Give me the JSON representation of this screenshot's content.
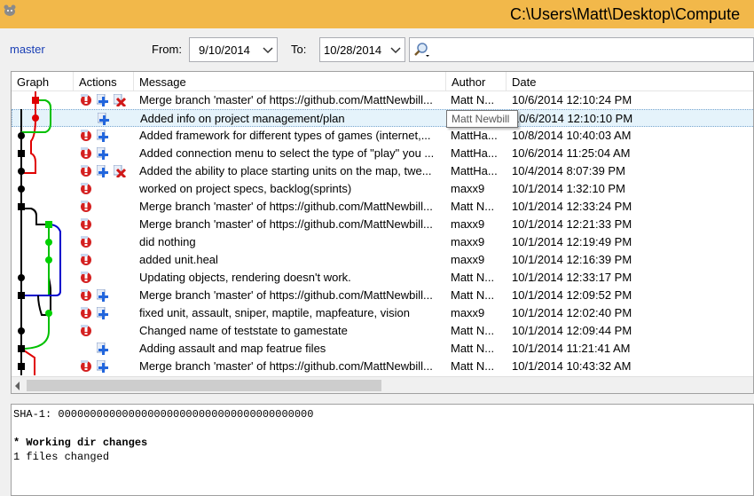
{
  "window": {
    "title": "C:\\Users\\Matt\\Desktop\\Compute"
  },
  "filter": {
    "branch": "master",
    "from_label": "From:",
    "from_date": "9/10/2014",
    "to_label": "To:",
    "to_date": "10/28/2014",
    "search_value": ""
  },
  "columns": {
    "graph": "Graph",
    "actions": "Actions",
    "message": "Message",
    "author": "Author",
    "date": "Date"
  },
  "rows": [
    {
      "message": "Merge branch 'master' of https://github.com/MattNewbill...",
      "author": "Matt N...",
      "date": "10/6/2014 12:10:24 PM",
      "actions": [
        "conflict-icon",
        "add-icon",
        "remove-icon"
      ]
    },
    {
      "message": "Added info on project management/plan",
      "author": "Matt N...",
      "date": "10/6/2014 12:10:10 PM",
      "actions": [
        "add-icon"
      ]
    },
    {
      "message": "Added framework for different types of games (internet,...",
      "author": "MattHa...",
      "date": "10/8/2014 10:40:03 AM",
      "actions": [
        "conflict-icon",
        "add-icon"
      ]
    },
    {
      "message": "Added connection menu to select the type of \"play\" you ...",
      "author": "MattHa...",
      "date": "10/6/2014 11:25:04 AM",
      "actions": [
        "conflict-icon",
        "add-icon"
      ]
    },
    {
      "message": "Added the ability to place starting units on the map, twe...",
      "author": "MattHa...",
      "date": "10/4/2014 8:07:39 PM",
      "actions": [
        "conflict-icon",
        "add-icon",
        "remove-icon"
      ]
    },
    {
      "message": "worked on project specs, backlog(sprints)",
      "author": "maxx9",
      "date": "10/1/2014 1:32:10 PM",
      "actions": [
        "conflict-icon"
      ]
    },
    {
      "message": "Merge branch 'master' of https://github.com/MattNewbill...",
      "author": "Matt N...",
      "date": "10/1/2014 12:33:24 PM",
      "actions": [
        "conflict-icon"
      ]
    },
    {
      "message": "Merge branch 'master' of https://github.com/MattNewbill...",
      "author": "maxx9",
      "date": "10/1/2014 12:21:33 PM",
      "actions": [
        "conflict-icon"
      ]
    },
    {
      "message": "did nothing",
      "author": "maxx9",
      "date": "10/1/2014 12:19:49 PM",
      "actions": [
        "conflict-icon"
      ]
    },
    {
      "message": "added unit.heal",
      "author": "maxx9",
      "date": "10/1/2014 12:16:39 PM",
      "actions": [
        "conflict-icon"
      ]
    },
    {
      "message": "Updating objects, rendering doesn't work.",
      "author": "Matt N...",
      "date": "10/1/2014 12:33:17 PM",
      "actions": [
        "conflict-icon"
      ]
    },
    {
      "message": "Merge branch 'master' of https://github.com/MattNewbill...",
      "author": "Matt N...",
      "date": "10/1/2014 12:09:52 PM",
      "actions": [
        "conflict-icon",
        "add-icon"
      ]
    },
    {
      "message": "fixed unit, assault, sniper, maptile, mapfeature, vision",
      "author": "maxx9",
      "date": "10/1/2014 12:02:40 PM",
      "actions": [
        "conflict-icon",
        "add-icon"
      ]
    },
    {
      "message": "Changed name of teststate to gamestate",
      "author": "Matt N...",
      "date": "10/1/2014 12:09:44 PM",
      "actions": [
        "conflict-icon"
      ]
    },
    {
      "message": "Adding assault and map featrue files",
      "author": "Matt N...",
      "date": "10/1/2014 11:21:41 AM",
      "actions": [
        "add-icon"
      ]
    },
    {
      "message": "Merge branch 'master' of https://github.com/MattNewbill...",
      "author": "Matt N...",
      "date": "10/1/2014 10:43:32 AM",
      "actions": [
        "conflict-icon",
        "add-icon"
      ]
    }
  ],
  "tooltip": {
    "text": "Matt Newbill"
  },
  "details": {
    "sha_line": "SHA-1: 0000000000000000000000000000000000000000",
    "working_line": "* Working dir changes",
    "files_line": "1 files changed"
  },
  "colors": {
    "titlebar": "#f2b84a",
    "branch_red": "#e00000",
    "branch_green": "#00d000",
    "branch_blue": "#0000cc",
    "branch_black": "#000000",
    "selection": "#e5f3fb"
  }
}
